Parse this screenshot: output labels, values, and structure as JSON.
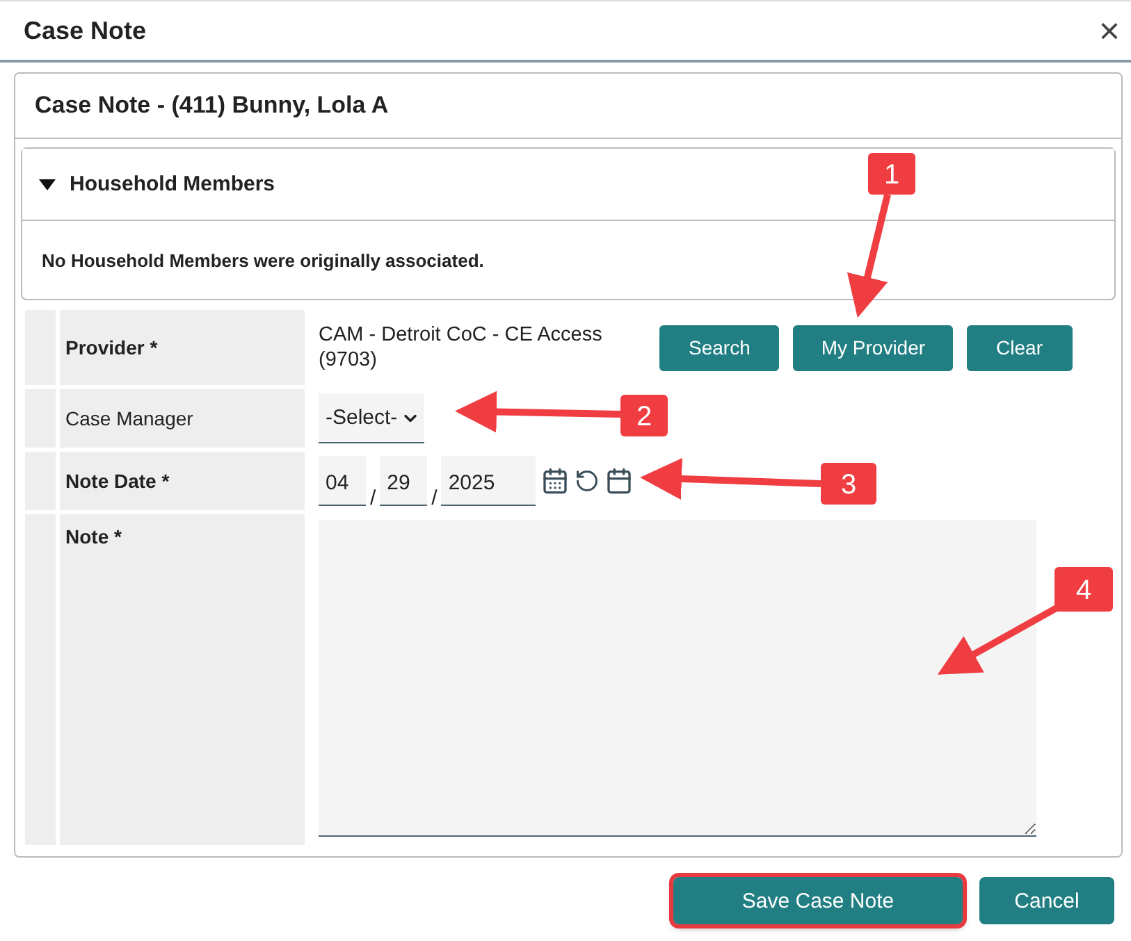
{
  "dialog": {
    "title": "Case Note",
    "close": "×"
  },
  "card": {
    "title": "Case Note - (411) Bunny, Lola A"
  },
  "household": {
    "title": "Household Members",
    "expanded": true,
    "message": "No Household Members were originally associated."
  },
  "form": [
    {
      "kind": "provider",
      "label": "Provider *",
      "required": true,
      "value": "CAM - Detroit CoC - CE Access (9703)",
      "buttons": [
        "Search",
        "My Provider",
        "Clear"
      ]
    },
    {
      "kind": "select",
      "label": "Case Manager",
      "required": false,
      "value": "-Select-"
    },
    {
      "kind": "date",
      "label": "Note Date *",
      "required": true,
      "month": "04",
      "day": "29",
      "year": "2025",
      "separator": "/"
    },
    {
      "kind": "textarea",
      "label": "Note *",
      "required": true
    }
  ],
  "footer": [
    {
      "label": "Save Case Note",
      "highlighted": true
    },
    {
      "label": "Cancel",
      "highlighted": false
    }
  ],
  "annotations": [
    {
      "label": "1"
    },
    {
      "label": "2"
    },
    {
      "label": "3"
    },
    {
      "label": "4"
    }
  ]
}
